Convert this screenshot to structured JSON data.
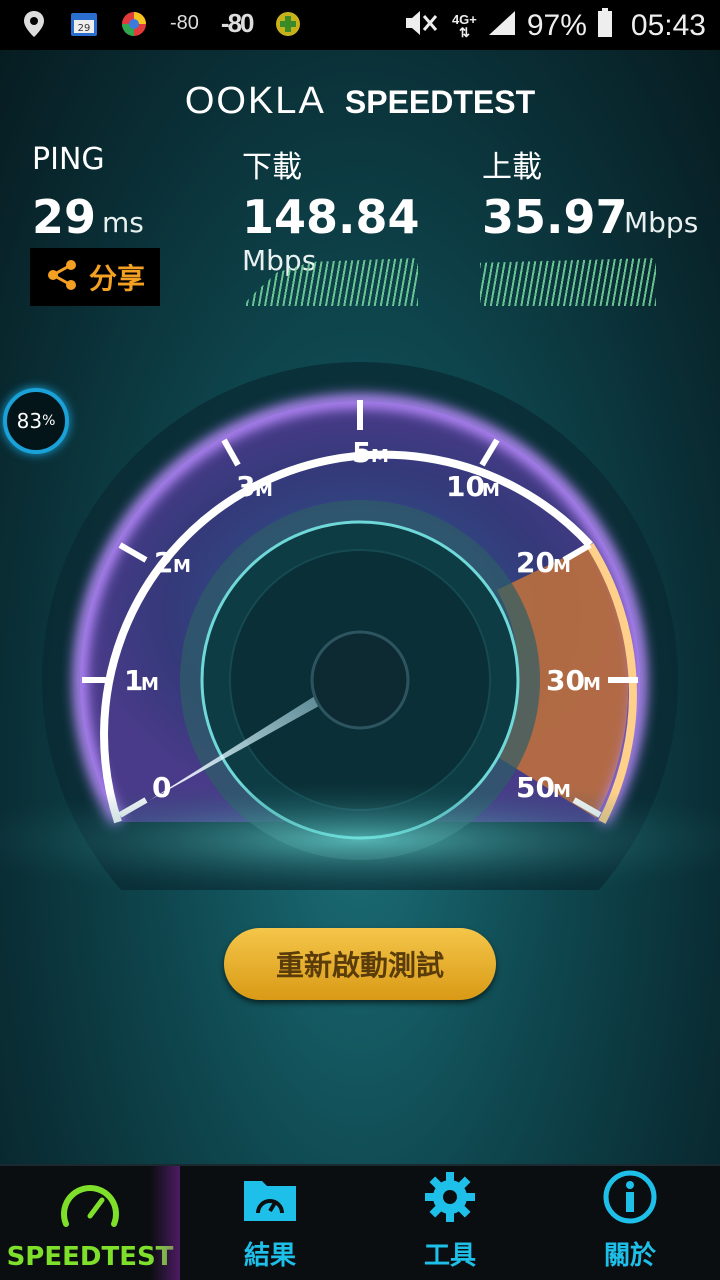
{
  "status_bar": {
    "left_items": [
      "location-icon",
      "calendar-icon",
      "browser-icon",
      "-80",
      "-80",
      "game-icon"
    ],
    "signal_text_1": "-80",
    "signal_text_2": "-80",
    "network": "4G+",
    "battery": "97%",
    "time": "05:43"
  },
  "header": {
    "brand": "OOKLA",
    "product": "SPEEDTEST"
  },
  "ping": {
    "label": "PING",
    "value": "29",
    "unit": "ms"
  },
  "download": {
    "label": "下載",
    "value": "148.84",
    "unit": "Mbps"
  },
  "upload": {
    "label": "上載",
    "value": "35.97",
    "unit": "Mbps"
  },
  "share": {
    "label": "分享"
  },
  "progress_badge": {
    "value": "83",
    "unit": "%"
  },
  "gauge": {
    "ticks": [
      {
        "num": "0",
        "unit": ""
      },
      {
        "num": "1",
        "unit": "M"
      },
      {
        "num": "2",
        "unit": "M"
      },
      {
        "num": "3",
        "unit": "M"
      },
      {
        "num": "5",
        "unit": "M"
      },
      {
        "num": "10",
        "unit": "M"
      },
      {
        "num": "20",
        "unit": "M"
      },
      {
        "num": "30",
        "unit": "M"
      },
      {
        "num": "50",
        "unit": "M"
      }
    ]
  },
  "restart_button": "重新啟動測試",
  "nav": [
    {
      "label": "SPEEDTEST",
      "icon": "speedometer-icon",
      "active": true
    },
    {
      "label": "結果",
      "icon": "results-folder-icon",
      "active": false
    },
    {
      "label": "工具",
      "icon": "gear-icon",
      "active": false
    },
    {
      "label": "關於",
      "icon": "info-icon",
      "active": false
    }
  ],
  "colors": {
    "accent": "#1ec0ea",
    "active": "#7fe02c",
    "share": "#f4a023",
    "button": "#e6ad2a"
  }
}
